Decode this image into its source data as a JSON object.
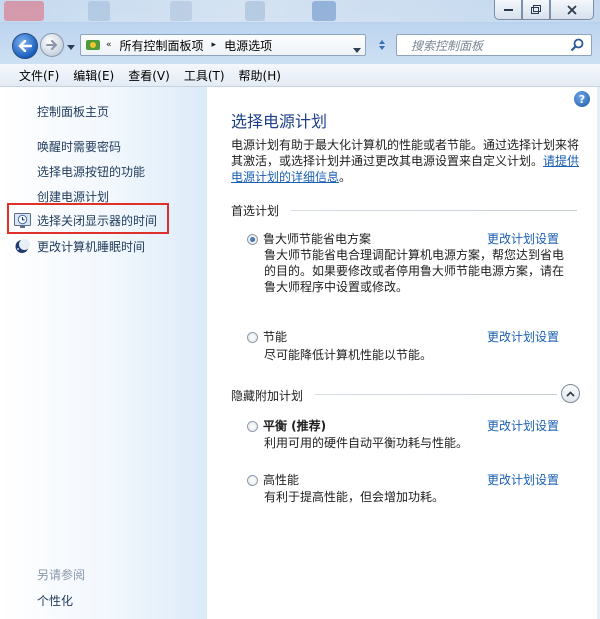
{
  "address_bar": {
    "breadcrumbs": [
      "所有控制面板项",
      "电源选项"
    ],
    "overflow_label": "«"
  },
  "search": {
    "placeholder": "搜索控制面板"
  },
  "menu": {
    "items": [
      {
        "label": "文件(F)"
      },
      {
        "label": "编辑(E)"
      },
      {
        "label": "查看(V)"
      },
      {
        "label": "工具(T)"
      },
      {
        "label": "帮助(H)"
      }
    ]
  },
  "sidebar": {
    "home": "控制面板主页",
    "items": [
      {
        "label": "唤醒时需要密码"
      },
      {
        "label": "选择电源按钮的功能"
      },
      {
        "label": "创建电源计划"
      },
      {
        "label": "选择关闭显示器的时间",
        "icon": "clock-icon"
      },
      {
        "label": "更改计算机睡眠时间",
        "icon": "moon-icon"
      }
    ],
    "see_also": "另请参阅",
    "personalize": "个性化"
  },
  "main": {
    "help": "?",
    "title": "选择电源计划",
    "intro_text": "电源计划有助于最大化计算机的性能或者节能。通过选择计划来将其激活，或选择计划并通过更改其电源设置来自定义计划。",
    "intro_link": "请提供电源计划的详细信息",
    "intro_end": "。",
    "preferred_section": "首选计划",
    "hidden_section": "隐藏附加计划",
    "change_label": "更改计划设置",
    "plans": [
      {
        "name": "鲁大师节能省电方案",
        "desc": "鲁大师节能省电合理调配计算机电源方案，帮您达到省电的目的。如果要修改或者停用鲁大师节能电源方案，请在鲁大师程序中设置或修改。",
        "selected": true
      },
      {
        "name": "节能",
        "desc": "尽可能降低计算机性能以节能。",
        "selected": false
      },
      {
        "name": "平衡 (推荐)",
        "desc": "利用可用的硬件自动平衡功耗与性能。",
        "selected": false
      },
      {
        "name": "高性能",
        "desc": "有利于提高性能，但会增加功耗。",
        "selected": false
      }
    ]
  },
  "colors": {
    "accent_link": "#1a5fb4",
    "title": "#1e3f8a",
    "highlight_border": "#e0302a"
  }
}
